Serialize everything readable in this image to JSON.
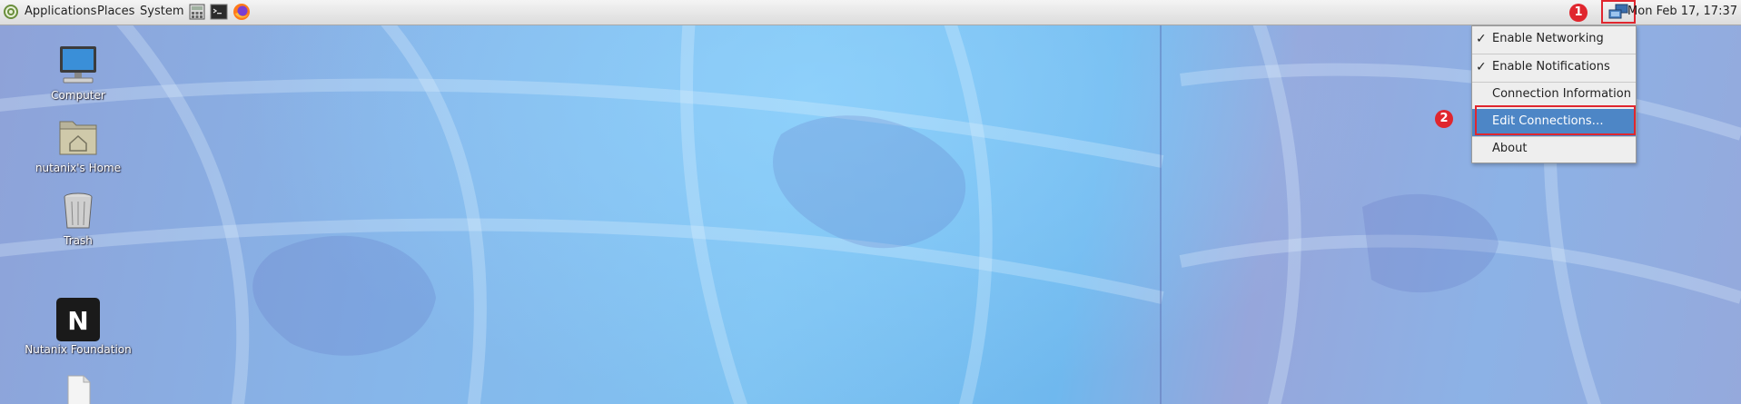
{
  "panel": {
    "menus": [
      "Applications",
      "Places",
      "System"
    ],
    "clock": "Mon Feb 17, 17:37"
  },
  "annotations": {
    "step1": "1",
    "step2": "2"
  },
  "network_menu": {
    "items": [
      {
        "label": "Enable Networking",
        "checked": true
      },
      {
        "label": "Enable Notifications",
        "checked": true
      },
      {
        "label": "Connection Information",
        "checked": false
      },
      {
        "label": "Edit Connections…",
        "checked": false,
        "selected": true
      },
      {
        "label": "About",
        "checked": false
      }
    ],
    "check_glyph": "✓"
  },
  "desktop_icons": [
    {
      "label": "Computer",
      "icon": "computer-icon"
    },
    {
      "label": "nutanix's Home",
      "icon": "home-folder-icon"
    },
    {
      "label": "Trash",
      "icon": "trash-icon"
    },
    {
      "label": "Nutanix Foundation",
      "icon": "nutanix-icon",
      "glyph": "N"
    },
    {
      "label": "",
      "icon": "file-icon"
    }
  ],
  "colors": {
    "annotation_red": "#e0262e",
    "menu_selected": "#4d86c6",
    "panel_bg": "#e6e6e6"
  }
}
